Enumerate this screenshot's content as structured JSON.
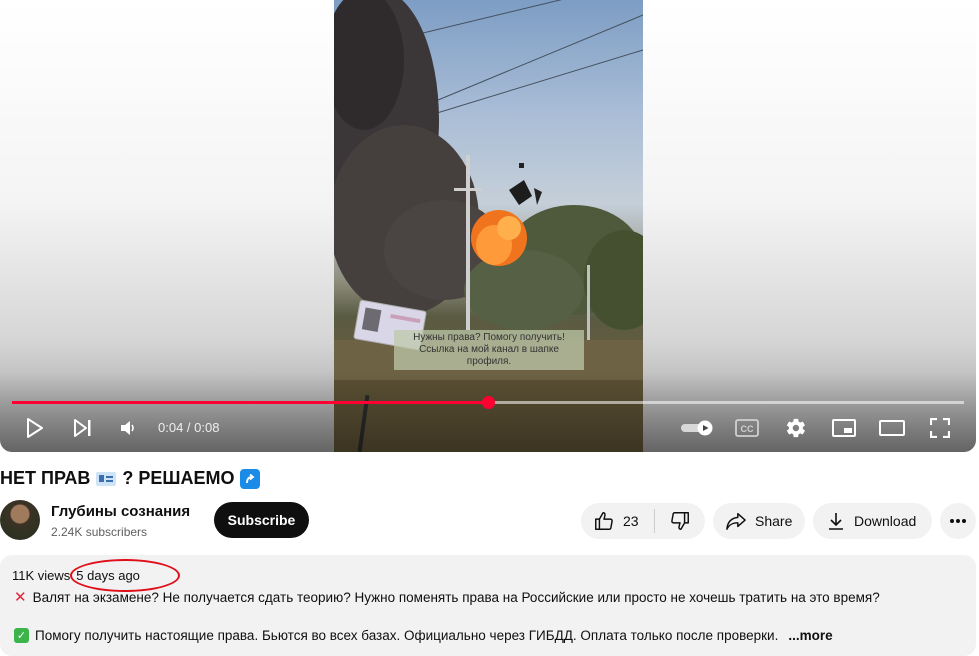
{
  "player": {
    "overlay_text_line1": "Нужны права? Помогу получить!",
    "overlay_text_line2": "Ссылка на мой канал в шапке профиля.",
    "current_time": "0:04",
    "duration": "0:08",
    "time_display": "0:04 / 0:08",
    "progress_fraction": 0.5,
    "accent_color": "#ff0033",
    "icons": [
      "play-icon",
      "next-icon",
      "volume-icon",
      "autoplay-toggle-icon",
      "captions-icon",
      "settings-icon",
      "miniplayer-icon",
      "theater-icon",
      "fullscreen-icon"
    ]
  },
  "video": {
    "title_part1": "НЕТ ПРАВ",
    "title_part2": "? РЕШАЕМО"
  },
  "channel": {
    "name": "Глубины сознания",
    "subscribers": "2.24K subscribers",
    "subscribe_label": "Subscribe"
  },
  "actions": {
    "like_count": "23",
    "share_label": "Share",
    "download_label": "Download"
  },
  "description": {
    "views": "11K views",
    "age": "5 days ago",
    "line1": "Валят на экзамене? Не получается сдать теорию? Нужно поменять права на Российские или просто не хочешь тратить на это время?",
    "line2": "Помогу получить настоящие права. Бьются во всех базах. Официально через ГИБДД. Оплата только после проверки.",
    "more_label": "...more",
    "annotation_color": "#e0101a"
  }
}
